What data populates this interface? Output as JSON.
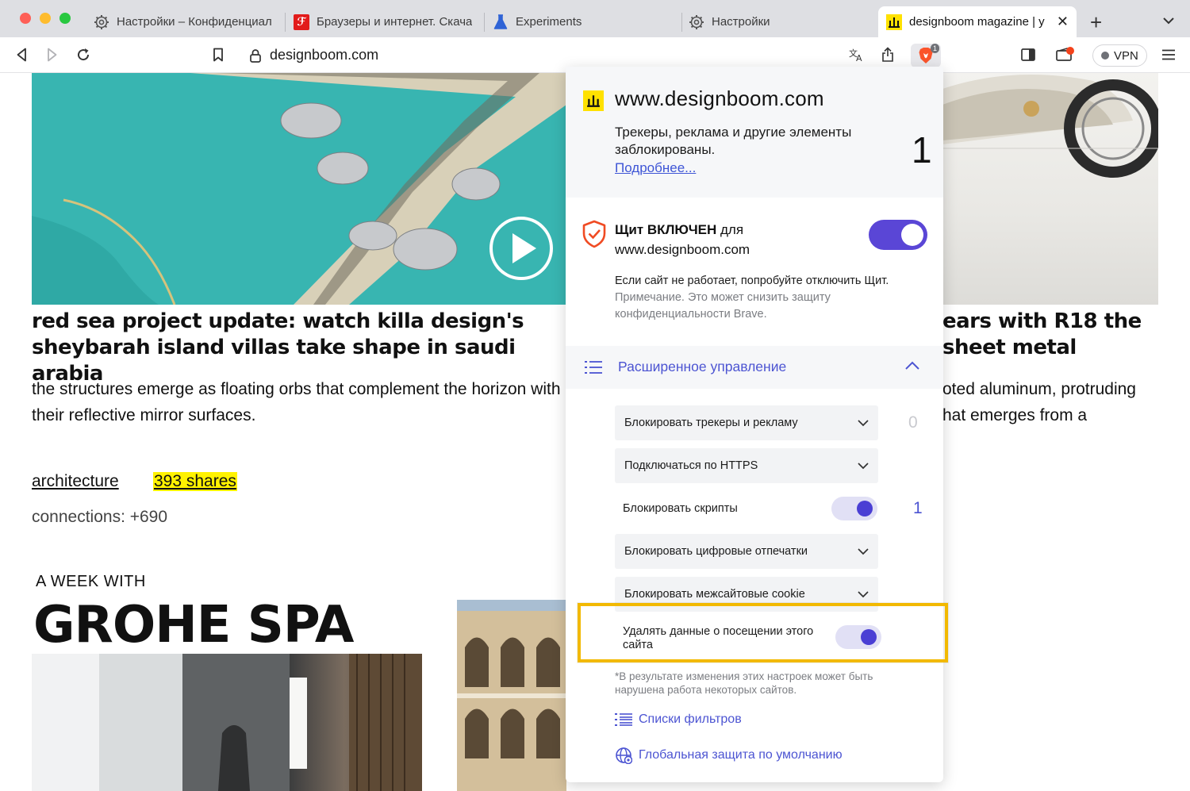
{
  "tabs": [
    {
      "label": "Настройки – Конфиденциал",
      "icon": "gear-icon"
    },
    {
      "label": "Браузеры и интернет. Скача",
      "icon": "red-logo-icon"
    },
    {
      "label": "Experiments",
      "icon": "flask-icon"
    },
    {
      "label": "Настройки",
      "icon": "gear-icon"
    },
    {
      "label": "designboom magazine | y",
      "icon": "designboom-logo-icon",
      "active": true
    }
  ],
  "toolbar": {
    "url": "designboom.com",
    "vpn_label": "VPN",
    "shields_badge": "1"
  },
  "articles": [
    {
      "title": "red sea project update: watch killa design's sheybarah island villas take shape in saudi arabia",
      "description": "the structures emerge as floating orbs that complement the horizon with their reflective mirror surfaces.",
      "tag": "architecture",
      "shares": "393 shares",
      "connections": "connections: +690"
    },
    {
      "title": "ears with R18 the sheet metal",
      "title_line1": "ears with R18 the",
      "title_line2": "sheet metal",
      "desc_line1": "oted aluminum, protruding",
      "desc_line2": "hat emerges from a"
    }
  ],
  "promo": {
    "week_label": "A WEEK WITH",
    "title": "GROHE SPA"
  },
  "shields_panel": {
    "site_host": "www.designboom.com",
    "blocked_text": "Трекеры, реклама и другие элементы заблокированы.",
    "learn_more": "Подробнее...",
    "blocked_count": "1",
    "shield_state_bold": "Щит ВКЛЮЧЕН",
    "shield_state_rest": " для",
    "shield_site": "www.designboom.com",
    "shield_enabled": true,
    "hint_main": "Если сайт не работает, попробуйте отключить Щит.",
    "hint_note": "Примечание. Это может снизить защиту конфиденциальности Brave.",
    "advanced_label": "Расширенное управление",
    "controls": [
      {
        "label": "Блокировать трекеры и рекламу",
        "type": "select",
        "count": "0"
      },
      {
        "label": "Подключаться по HTTPS",
        "type": "select"
      },
      {
        "label": "Блокировать скрипты",
        "type": "toggle",
        "enabled": true,
        "count": "1"
      },
      {
        "label": "Блокировать цифровые отпечатки",
        "type": "select"
      },
      {
        "label": "Блокировать межсайтовые cookie",
        "type": "select"
      }
    ],
    "clear_data_label": "Удалять данные о посещении этого сайта",
    "clear_data_enabled": true,
    "footnote": "*В результате изменения этих настроек может быть нарушена работа некоторых сайтов.",
    "filter_lists": "Списки фильтров",
    "global_defaults": "Глобальная защита по умолчанию"
  },
  "colors": {
    "accent": "#4c54d2",
    "toggle_on": "#5a46d6",
    "highlight": "#f2b900",
    "shares_bg": "#fff200"
  }
}
